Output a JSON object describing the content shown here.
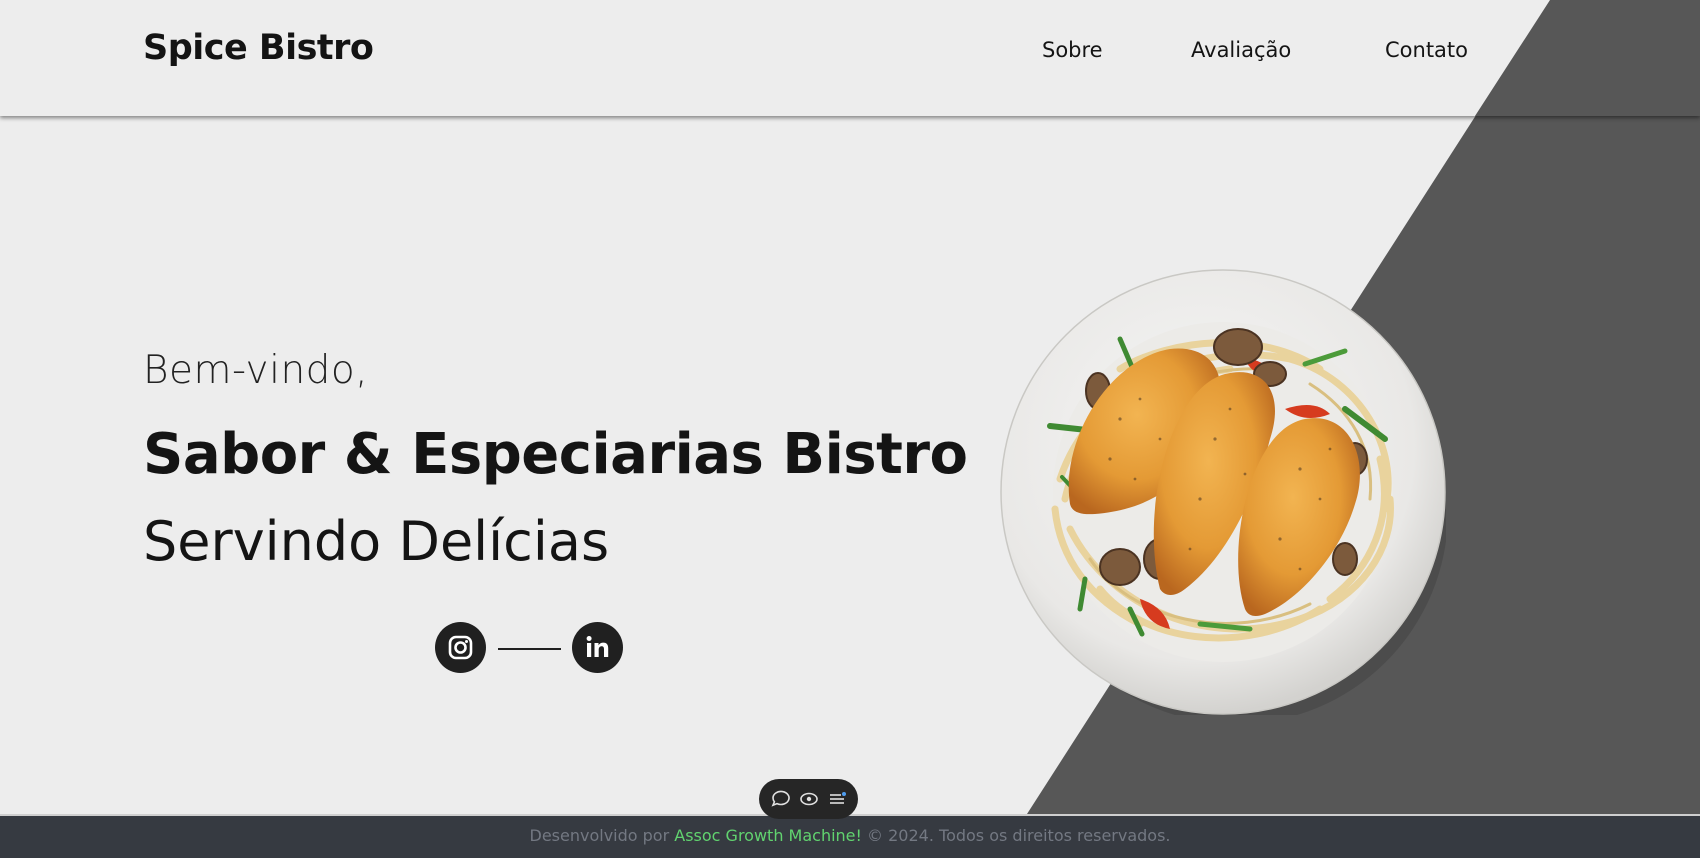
{
  "header": {
    "logo": "Spice Bistro",
    "nav": [
      {
        "label": "Sobre"
      },
      {
        "label": "Avaliação"
      },
      {
        "label": "Contato"
      }
    ]
  },
  "hero": {
    "greeting": "Bem-vindo,",
    "headline": "Sabor & Especiarias Bistro",
    "subline": "Servindo Delícias",
    "image": "grilled-chicken-pasta-plate",
    "social": [
      "instagram-icon",
      "linkedin-icon"
    ]
  },
  "footer": {
    "prefix": "Desenvolvido por",
    "brand": "Assoc Growth Machine!",
    "suffix": "© 2024. Todos os direitos reservados."
  },
  "toolbar": {
    "icons": [
      "comment-icon",
      "eye-icon",
      "menu-icon"
    ]
  },
  "colors": {
    "background": "#ededed",
    "diagonal_panel": "#575757",
    "footer_bg": "#363a41",
    "footer_text": "#737882",
    "footer_brand": "#61d36f",
    "icon_dark": "#202020"
  }
}
